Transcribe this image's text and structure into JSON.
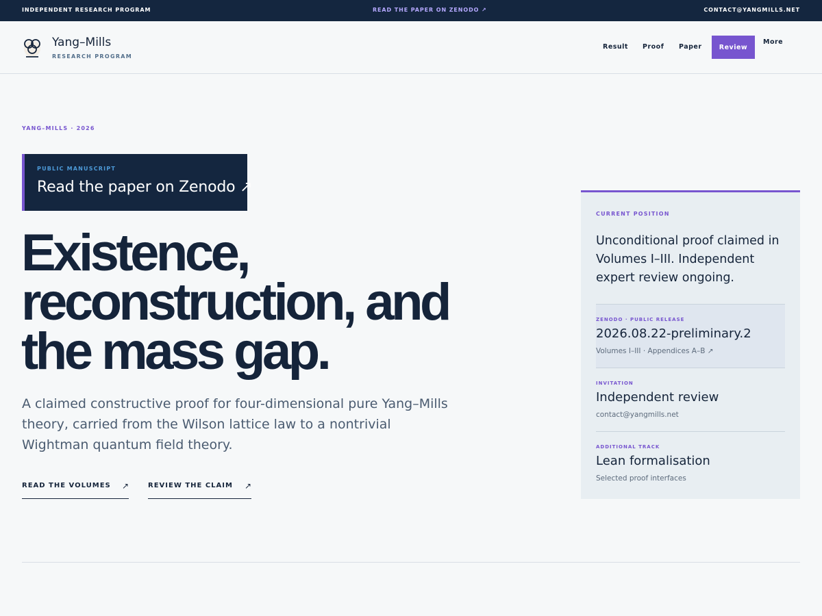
{
  "topbar": {
    "left": "INDEPENDENT RESEARCH PROGRAM",
    "center": "READ THE PAPER ON ZENODO ↗",
    "right": "CONTACT@YANGMILLS.NET"
  },
  "nav": {
    "brand": "Yang–Mills",
    "brand_sub": "RESEARCH PROGRAM",
    "links": {
      "result": "Result",
      "proof": "Proof",
      "paper": "Paper",
      "review": "Review",
      "more": "More"
    }
  },
  "hero": {
    "eyebrow": "YANG–MILLS · 2026",
    "zenodo_card": {
      "label": "PUBLIC MANUSCRIPT",
      "title": "Read the paper on Zenodo ↗"
    },
    "headline": [
      "Existence,",
      "reconstruction, and",
      "the mass gap."
    ],
    "lede": "A claimed constructive proof for four-dimensional pure Yang–Mills theory, carried from the Wilson lattice law to a nontrivial Wightman quantum field theory.",
    "cta": {
      "read_volumes": "READ THE VOLUMES",
      "review_claim": "REVIEW THE CLAIM",
      "arrow": "↗"
    }
  },
  "panel": {
    "label": "CURRENT POSITION",
    "position": "Unconditional proof claimed in Volumes I–III. Independent expert review ongoing.",
    "items": [
      {
        "label": "ZENODO · PUBLIC RELEASE",
        "title": "2026.08.22-preliminary.2",
        "sub": "Volumes I–III · Appendices A–B ↗"
      },
      {
        "label": "INVITATION",
        "title": "Independent review",
        "sub": "contact@yangmills.net"
      },
      {
        "label": "ADDITIONAL TRACK",
        "title": "Lean formalisation",
        "sub": "Selected proof interfaces"
      }
    ]
  },
  "colors": {
    "navy": "#14263f",
    "accent": "#7755cf",
    "background": "#f6f8f9",
    "panel": "#e8eef2"
  },
  "icons": {
    "logo": "knot-logo-icon",
    "arrow": "arrow-up-right-icon"
  }
}
